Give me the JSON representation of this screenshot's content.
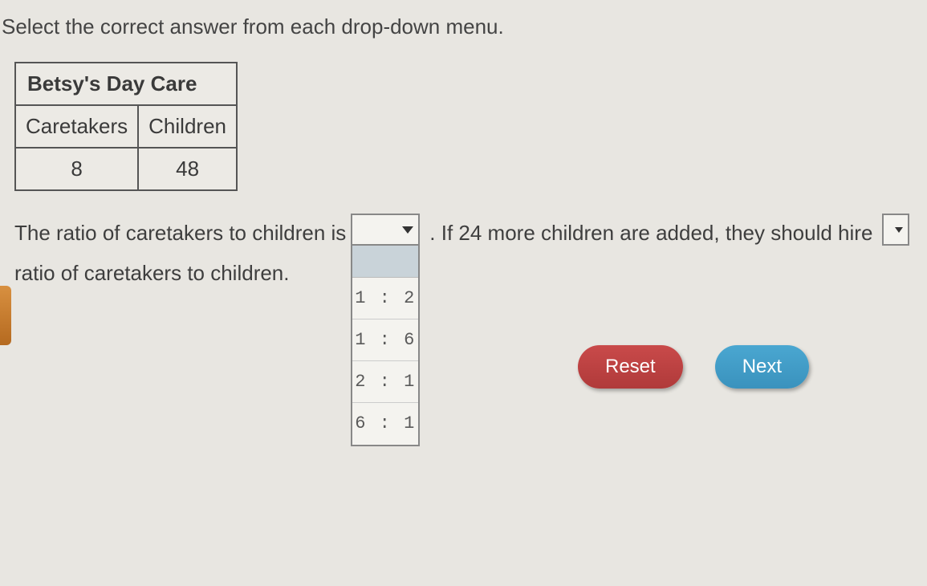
{
  "instruction": "Select the correct answer from each drop-down menu.",
  "table": {
    "title": "Betsy's Day Care",
    "headers": [
      "Caretakers",
      "Children"
    ],
    "row": [
      "8",
      "48"
    ]
  },
  "sentence": {
    "part1": "The ratio of caretakers to children is",
    "part2": ". If 24 more children are added, they should hire",
    "part3": "ratio of caretakers to children."
  },
  "dropdown1": {
    "selected": "",
    "options": [
      "1 : 2",
      "1 : 6",
      "2 : 1",
      "6 : 1"
    ]
  },
  "dropdown2": {
    "selected": ""
  },
  "buttons": {
    "reset": "Reset",
    "next": "Next"
  }
}
